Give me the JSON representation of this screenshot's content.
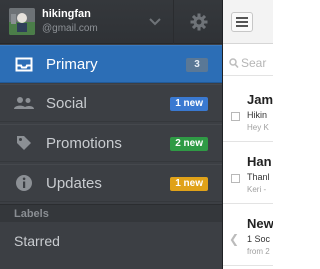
{
  "account": {
    "name": "hikingfan",
    "email": "@gmail.com"
  },
  "nav": {
    "items": [
      {
        "label": "Primary",
        "badge": "3",
        "icon": "inbox-icon",
        "active": true
      },
      {
        "label": "Social",
        "badge": "1 new",
        "icon": "people-icon",
        "active": false
      },
      {
        "label": "Promotions",
        "badge": "2 new",
        "icon": "tag-icon",
        "active": false
      },
      {
        "label": "Updates",
        "badge": "1 new",
        "icon": "info-icon",
        "active": false
      }
    ],
    "labels_header": "Labels",
    "starred": "Starred"
  },
  "inbox": {
    "search_placeholder": "Sear",
    "messages": [
      {
        "from": "Jam",
        "subject": "Hikin",
        "snippet": "Hey K"
      },
      {
        "from": "Han",
        "subject": "Thanl",
        "snippet": "Keri -"
      },
      {
        "from": "New",
        "subject": "1 Soc",
        "snippet": "from 2"
      }
    ]
  },
  "colors": {
    "sidebar_bg": "#3c3f44",
    "active_bg": "#2c6eb6",
    "badge_social": "#3a79d1",
    "badge_promotions": "#2f9a45",
    "badge_updates": "#e0a219"
  }
}
